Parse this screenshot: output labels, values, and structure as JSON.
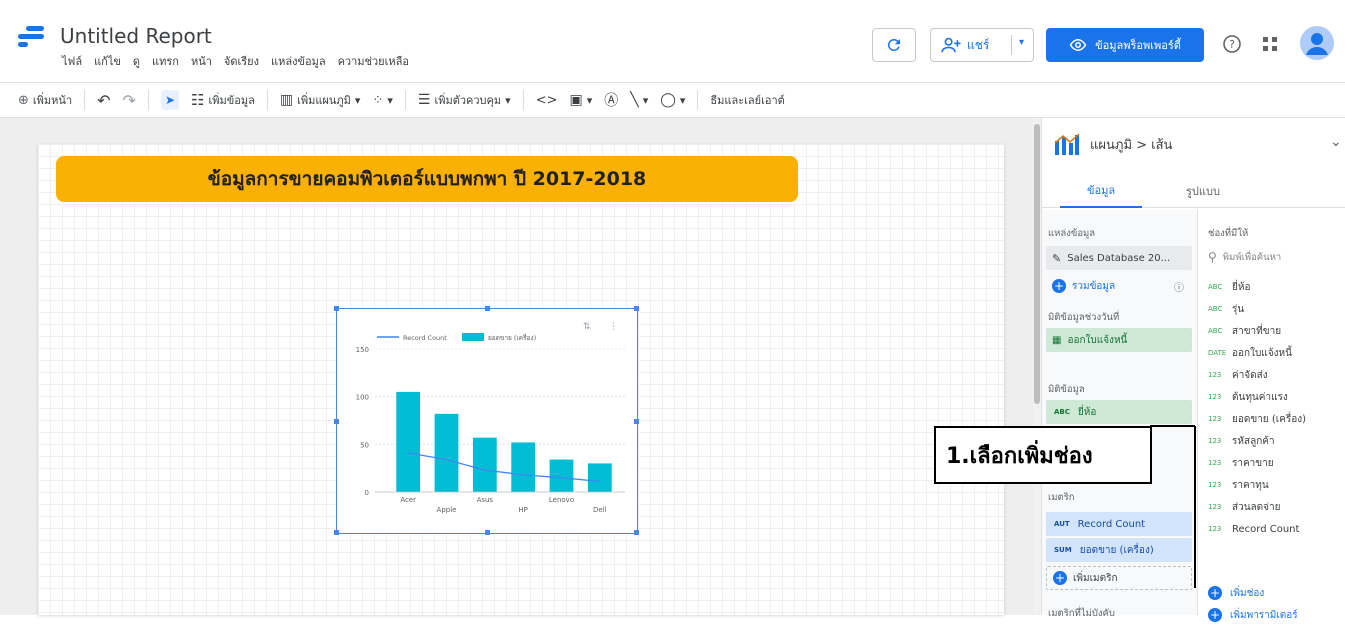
{
  "header": {
    "title": "Untitled Report",
    "menu": [
      "ไฟล์",
      "แก้ไข",
      "ดู",
      "แทรก",
      "หน้า",
      "จัดเรียง",
      "แหล่งข้อมูล",
      "ความช่วยเหลือ"
    ],
    "share_label": "แชร์",
    "props_label": "ข้อมูลพร็อพเพอร์ตี้"
  },
  "toolbar": {
    "add_page": "เพิ่มหน้า",
    "add_data": "เพิ่มข้อมูล",
    "add_chart": "เพิ่มแผนภูมิ",
    "add_control": "เพิ่มตัวควบคุม",
    "theme_layout": "ธีมและเลย์เอาต์"
  },
  "canvas": {
    "banner_title": "ข้อมูลการขายคอมพิวเตอร์แบบพกพา ปี 2017-2018"
  },
  "chart_data": {
    "type": "bar",
    "categories": [
      "Acer",
      "Apple",
      "Asus",
      "HP",
      "Lenovo",
      "Dell"
    ],
    "series": [
      {
        "name": "ยอดขาย (เครื่อง)",
        "type": "bar",
        "values": [
          105,
          82,
          57,
          52,
          34,
          30
        ]
      },
      {
        "name": "Record Count",
        "type": "line",
        "values": [
          41,
          34,
          23,
          18,
          15,
          11
        ]
      }
    ],
    "yticks": [
      0,
      50,
      100,
      150
    ],
    "ylim": [
      0,
      150
    ],
    "legend_position": "top",
    "grid": true,
    "colors": {
      "bar": "#00bcd4",
      "line": "#4285f4"
    }
  },
  "panel": {
    "breadcrumb": "แผนภูมิ > เส้น",
    "tabs": {
      "data": "ข้อมูล",
      "style": "รูปแบบ"
    },
    "left": {
      "datasource_title": "แหล่งข้อมูล",
      "datasource_name": "Sales Database 20...",
      "blend_label": "รวมข้อมูล",
      "date_range_title": "มิติข้อมูลช่วงวันที่",
      "date_field": "ออกใบแจ้งหนี้",
      "dimension_title": "มิติข้อมูล",
      "dimension_field": "ยี่ห้อ",
      "metric_title": "เมตริก",
      "metric_fields": [
        {
          "tag": "AUT",
          "label": "Record Count"
        },
        {
          "tag": "SUM",
          "label": "ยอดขาย (เครื่อง)"
        }
      ],
      "add_metric": "เพิ่มเมตริก",
      "optional_metrics": "เมตริกที่ไม่บังคับ"
    },
    "right": {
      "title": "ช่องที่มีให้",
      "search_placeholder": "พิมพ์เพื่อค้นหา",
      "fields": [
        {
          "type": "ABC",
          "label": "ยี่ห้อ"
        },
        {
          "type": "ABC",
          "label": "รุ่น"
        },
        {
          "type": "ABC",
          "label": "สาขาที่ขาย"
        },
        {
          "type": "DATE",
          "label": "ออกใบแจ้งหนี้"
        },
        {
          "type": "123",
          "label": "ค่าจัดส่ง"
        },
        {
          "type": "123",
          "label": "ต้นทุนค่าแรง"
        },
        {
          "type": "123",
          "label": "ยอดขาย (เครื่อง)"
        },
        {
          "type": "123",
          "label": "รหัสลูกค้า"
        },
        {
          "type": "123",
          "label": "ราคาขาย"
        },
        {
          "type": "123",
          "label": "ราคาทุน"
        },
        {
          "type": "123",
          "label": "ส่วนลดจ่าย"
        },
        {
          "type": "123",
          "label": "Record Count"
        }
      ],
      "add_field": "เพิ่มช่อง",
      "add_param": "เพิ่มพารามิเตอร์"
    }
  },
  "annotation": {
    "callout_text": "1.เลือกเพิ่มช่อง"
  }
}
